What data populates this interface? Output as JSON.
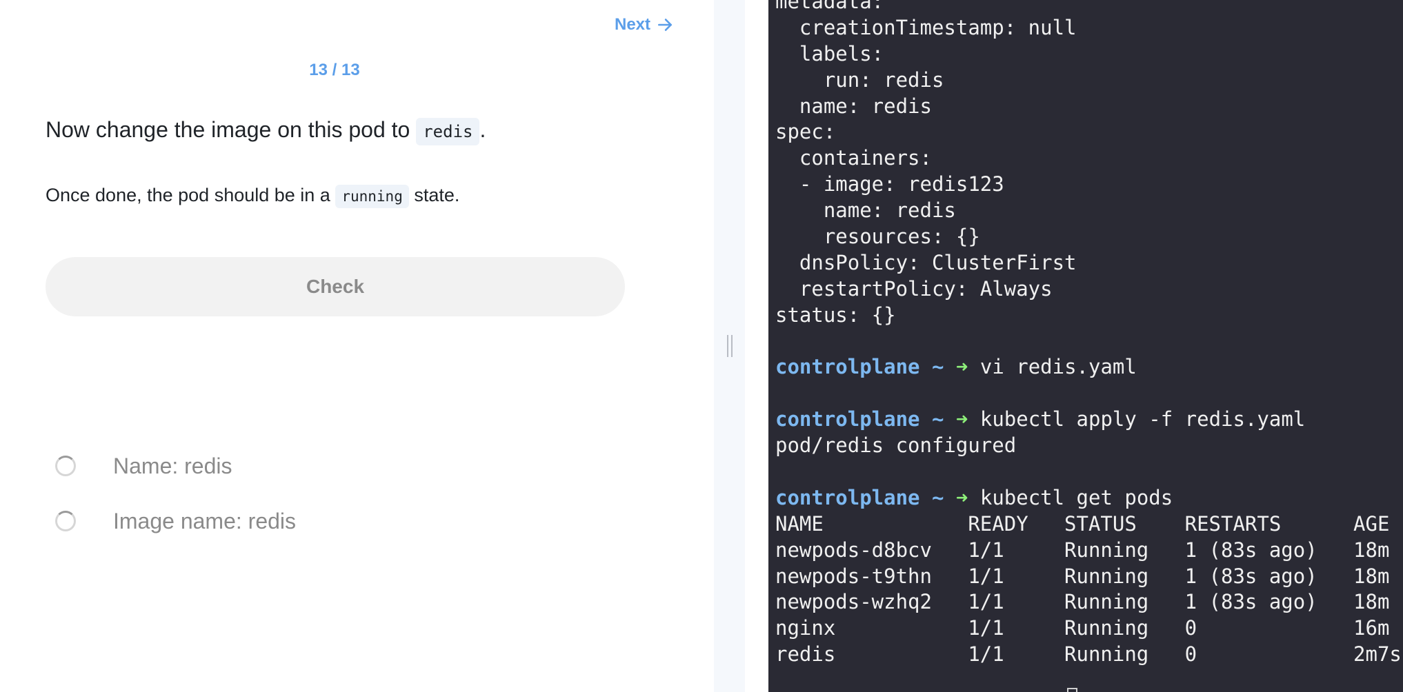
{
  "nav": {
    "next_label": "Next",
    "progress": "13 / 13"
  },
  "question": {
    "text_before": "Now change the image on this pod to",
    "code": "redis",
    "text_after": "."
  },
  "subtext": {
    "text_before": "Once done, the pod should be in a",
    "code": "running",
    "text_after": "state."
  },
  "check": {
    "label": "Check"
  },
  "criteria": [
    {
      "label": "Name: redis"
    },
    {
      "label": "Image name: redis"
    }
  ],
  "terminal": {
    "prompt_host": "controlplane",
    "prompt_tilde": "~",
    "prompt_arrow": "➜",
    "lines": [
      {
        "type": "text",
        "text": "metadata:"
      },
      {
        "type": "text",
        "text": "  creationTimestamp: null"
      },
      {
        "type": "text",
        "text": "  labels:"
      },
      {
        "type": "text",
        "text": "    run: redis"
      },
      {
        "type": "text",
        "text": "  name: redis"
      },
      {
        "type": "text",
        "text": "spec:"
      },
      {
        "type": "text",
        "text": "  containers:"
      },
      {
        "type": "text",
        "text": "  - image: redis123"
      },
      {
        "type": "text",
        "text": "    name: redis"
      },
      {
        "type": "text",
        "text": "    resources: {}"
      },
      {
        "type": "text",
        "text": "  dnsPolicy: ClusterFirst"
      },
      {
        "type": "text",
        "text": "  restartPolicy: Always"
      },
      {
        "type": "text",
        "text": "status: {}"
      },
      {
        "type": "text",
        "text": ""
      },
      {
        "type": "prompt",
        "command": "vi redis.yaml"
      },
      {
        "type": "text",
        "text": ""
      },
      {
        "type": "prompt",
        "command": "kubectl apply -f redis.yaml"
      },
      {
        "type": "text",
        "text": "pod/redis configured"
      },
      {
        "type": "text",
        "text": ""
      },
      {
        "type": "prompt",
        "command": "kubectl get pods"
      },
      {
        "type": "text",
        "text": "NAME            READY   STATUS    RESTARTS      AGE"
      },
      {
        "type": "text",
        "text": "newpods-d8bcv   1/1     Running   1 (83s ago)   18m"
      },
      {
        "type": "text",
        "text": "newpods-t9thn   1/1     Running   1 (83s ago)   18m"
      },
      {
        "type": "text",
        "text": "newpods-wzhq2   1/1     Running   1 (83s ago)   18m"
      },
      {
        "type": "text",
        "text": "nginx           1/1     Running   0             16m"
      },
      {
        "type": "text",
        "text": "redis           1/1     Running   0             2m7s"
      }
    ]
  },
  "colors": {
    "accent": "#5b9ee9",
    "terminal_bg": "#2a2a34",
    "prompt_host": "#7db8f0",
    "prompt_arrow": "#8ef07a"
  }
}
